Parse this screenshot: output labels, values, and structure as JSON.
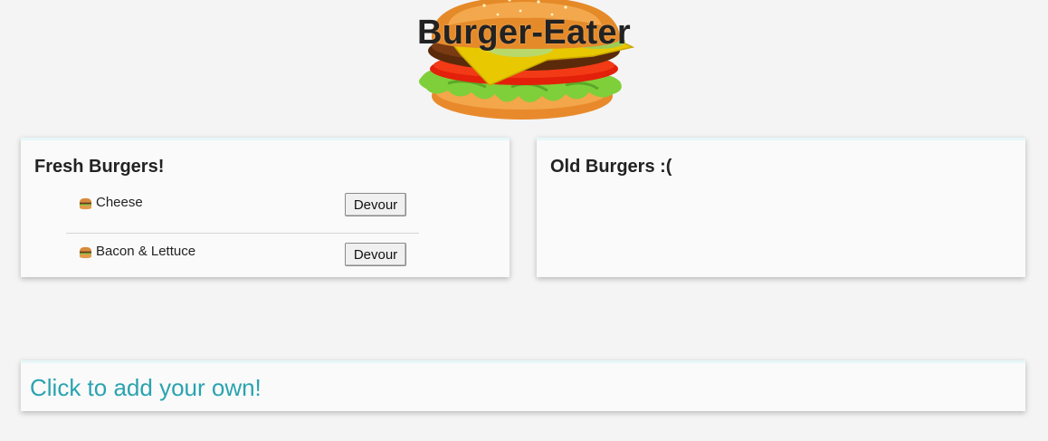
{
  "header": {
    "title": "Burger-Eater",
    "logo_icon": "burger-icon"
  },
  "fresh": {
    "title": "Fresh Burgers!",
    "items": [
      {
        "name": "Cheese",
        "button_label": "Devour"
      },
      {
        "name": "Bacon & Lettuce",
        "button_label": "Devour"
      }
    ]
  },
  "old": {
    "title": "Old Burgers :("
  },
  "add": {
    "label": "Click to add your own!"
  },
  "colors": {
    "background": "#f4f4f4",
    "panel": "#fafafa",
    "panel_top_border": "#e6f7f8",
    "link": "#2aa3b0"
  }
}
